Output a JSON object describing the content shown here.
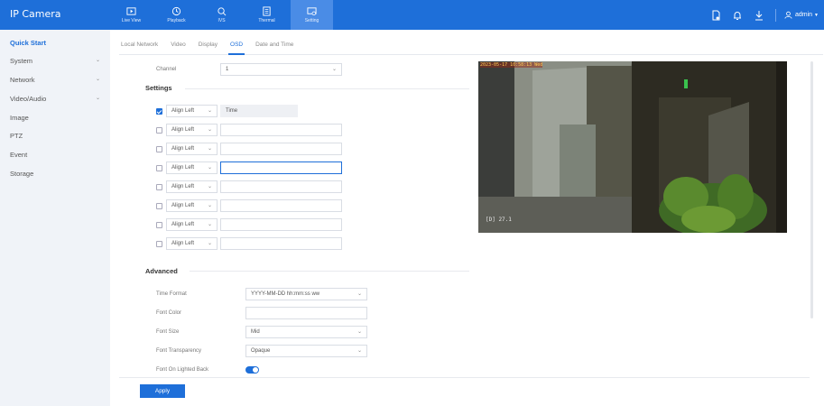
{
  "app": {
    "title": "IP Camera"
  },
  "topnav": [
    {
      "label": "Live View",
      "icon": "play-square-icon",
      "active": false
    },
    {
      "label": "Playback",
      "icon": "clock-icon",
      "active": false
    },
    {
      "label": "IVS",
      "icon": "ivs-icon",
      "active": false
    },
    {
      "label": "Thermal",
      "icon": "thermal-icon",
      "active": false
    },
    {
      "label": "Setting",
      "icon": "setting-icon",
      "active": true
    }
  ],
  "header": {
    "user": "admin"
  },
  "sidebar": {
    "items": [
      {
        "label": "Quick Start",
        "active": true,
        "expandable": false
      },
      {
        "label": "System",
        "active": false,
        "expandable": true
      },
      {
        "label": "Network",
        "active": false,
        "expandable": true
      },
      {
        "label": "Video/Audio",
        "active": false,
        "expandable": true
      },
      {
        "label": "Image",
        "active": false,
        "expandable": false
      },
      {
        "label": "PTZ",
        "active": false,
        "expandable": false
      },
      {
        "label": "Event",
        "active": false,
        "expandable": false
      },
      {
        "label": "Storage",
        "active": false,
        "expandable": false
      }
    ]
  },
  "subtabs": [
    {
      "label": "Local Network",
      "active": false
    },
    {
      "label": "Video",
      "active": false
    },
    {
      "label": "Display",
      "active": false
    },
    {
      "label": "OSD",
      "active": true
    },
    {
      "label": "Date and Time",
      "active": false
    }
  ],
  "channel": {
    "label": "Channel",
    "value": "1"
  },
  "settings": {
    "title": "Settings",
    "rows": [
      {
        "checked": true,
        "align": "Align Left",
        "text": "Time",
        "disabled": true,
        "focused": false
      },
      {
        "checked": false,
        "align": "Align Left",
        "text": "",
        "disabled": false,
        "focused": false
      },
      {
        "checked": false,
        "align": "Align Left",
        "text": "",
        "disabled": false,
        "focused": false
      },
      {
        "checked": false,
        "align": "Align Left",
        "text": "",
        "disabled": false,
        "focused": true
      },
      {
        "checked": false,
        "align": "Align Left",
        "text": "",
        "disabled": false,
        "focused": false
      },
      {
        "checked": false,
        "align": "Align Left",
        "text": "",
        "disabled": false,
        "focused": false
      },
      {
        "checked": false,
        "align": "Align Left",
        "text": "",
        "disabled": false,
        "focused": false
      },
      {
        "checked": false,
        "align": "Align Left",
        "text": "",
        "disabled": false,
        "focused": false
      }
    ]
  },
  "advanced": {
    "title": "Advanced",
    "time_format": {
      "label": "Time Format",
      "value": "YYYY-MM-DD hh:mm:ss ww"
    },
    "font_color": {
      "label": "Font Color",
      "value": ""
    },
    "font_size": {
      "label": "Font Size",
      "value": "Mid"
    },
    "font_transparency": {
      "label": "Font Transparency",
      "value": "Opaque"
    },
    "font_on_lighted_back": {
      "label": "Font On Lighted Back",
      "enabled": true
    }
  },
  "preview": {
    "osd_time": "2023-05-17 10:58:13 Wed",
    "osd_channel": "[D] 27.1"
  },
  "apply_label": "Apply",
  "colors": {
    "primary": "#1e6fd9",
    "sidebar_bg": "#f0f3f8"
  }
}
